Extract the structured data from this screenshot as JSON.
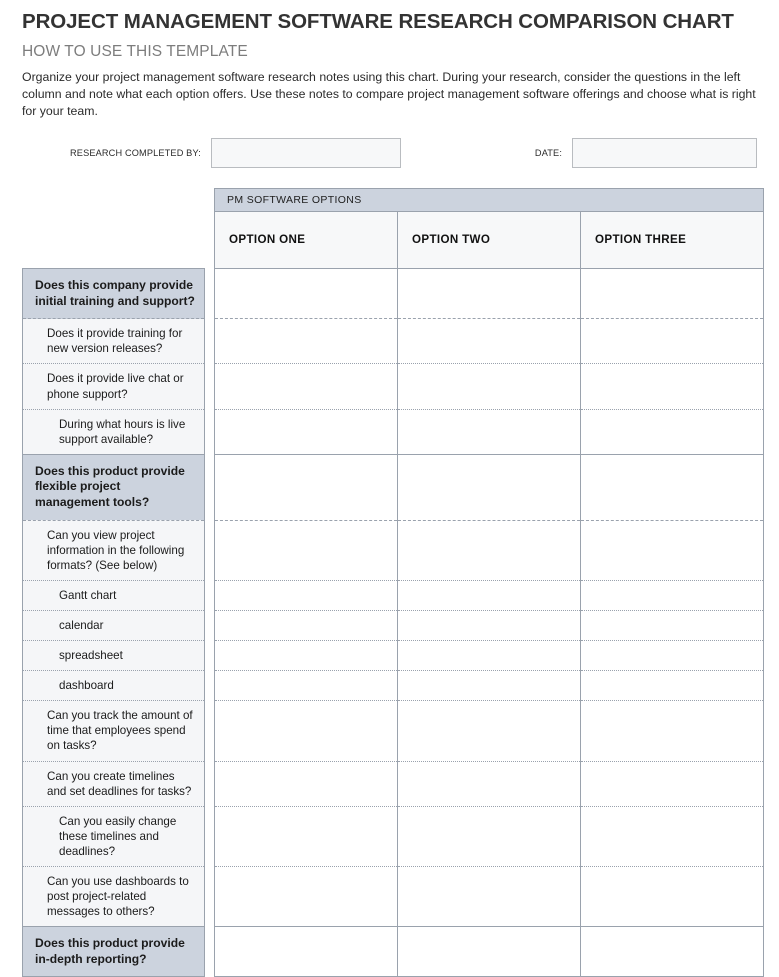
{
  "document": {
    "title": "PROJECT MANAGEMENT SOFTWARE RESEARCH COMPARISON CHART",
    "subtitle": "HOW TO USE THIS TEMPLATE",
    "intro": "Organize your project management software research notes using this chart. During your research, consider the questions in the left column and note what each option offers. Use these notes to compare project management software offerings and choose what is right for your team."
  },
  "meta": {
    "researcher_label": "RESEARCH COMPLETED BY:",
    "researcher_value": "",
    "date_label": "DATE:",
    "date_value": ""
  },
  "table": {
    "banner": "PM SOFTWARE OPTIONS",
    "columns": [
      "OPTION ONE",
      "OPTION TWO",
      "OPTION THREE"
    ],
    "rows": [
      {
        "level": 0,
        "sep": "solid",
        "text": "Does this company provide initial training and support?"
      },
      {
        "level": 1,
        "sep": "dashed",
        "text": "Does it provide training for new version releases?"
      },
      {
        "level": 1,
        "sep": "dotted",
        "text": "Does it provide live chat or phone support?"
      },
      {
        "level": 2,
        "sep": "dotted",
        "text": "During what hours is live support available?"
      },
      {
        "level": 0,
        "sep": "solid",
        "text": "Does this product provide flexible project management tools?"
      },
      {
        "level": 1,
        "sep": "dashed",
        "text": "Can you view project information in the following formats?  (See below)"
      },
      {
        "level": 2,
        "sep": "dotted",
        "text": "Gantt chart"
      },
      {
        "level": 2,
        "sep": "dotted",
        "text": "calendar"
      },
      {
        "level": 2,
        "sep": "dotted",
        "text": "spreadsheet"
      },
      {
        "level": 2,
        "sep": "dotted",
        "text": "dashboard"
      },
      {
        "level": 1,
        "sep": "dotted",
        "text": "Can you track the amount of time that employees spend on tasks?"
      },
      {
        "level": 1,
        "sep": "dotted",
        "text": "Can you create timelines and set deadlines for tasks?"
      },
      {
        "level": 2,
        "sep": "dotted",
        "text": "Can you easily change these timelines and deadlines?"
      },
      {
        "level": 1,
        "sep": "dotted",
        "text": "Can you use dashboards to post project-related messages to others?"
      },
      {
        "level": 0,
        "sep": "solid",
        "text": "Does this product provide  in-depth reporting?"
      }
    ]
  },
  "colors": {
    "banner_bg": "#ccd3de",
    "section_bg": "#ccd3de",
    "sub_bg": "#f5f6f8",
    "cell_bg": "#ffffff",
    "border": "#9aa2ad",
    "subtitle_text": "#7d7d7d",
    "title_text": "#333333"
  }
}
